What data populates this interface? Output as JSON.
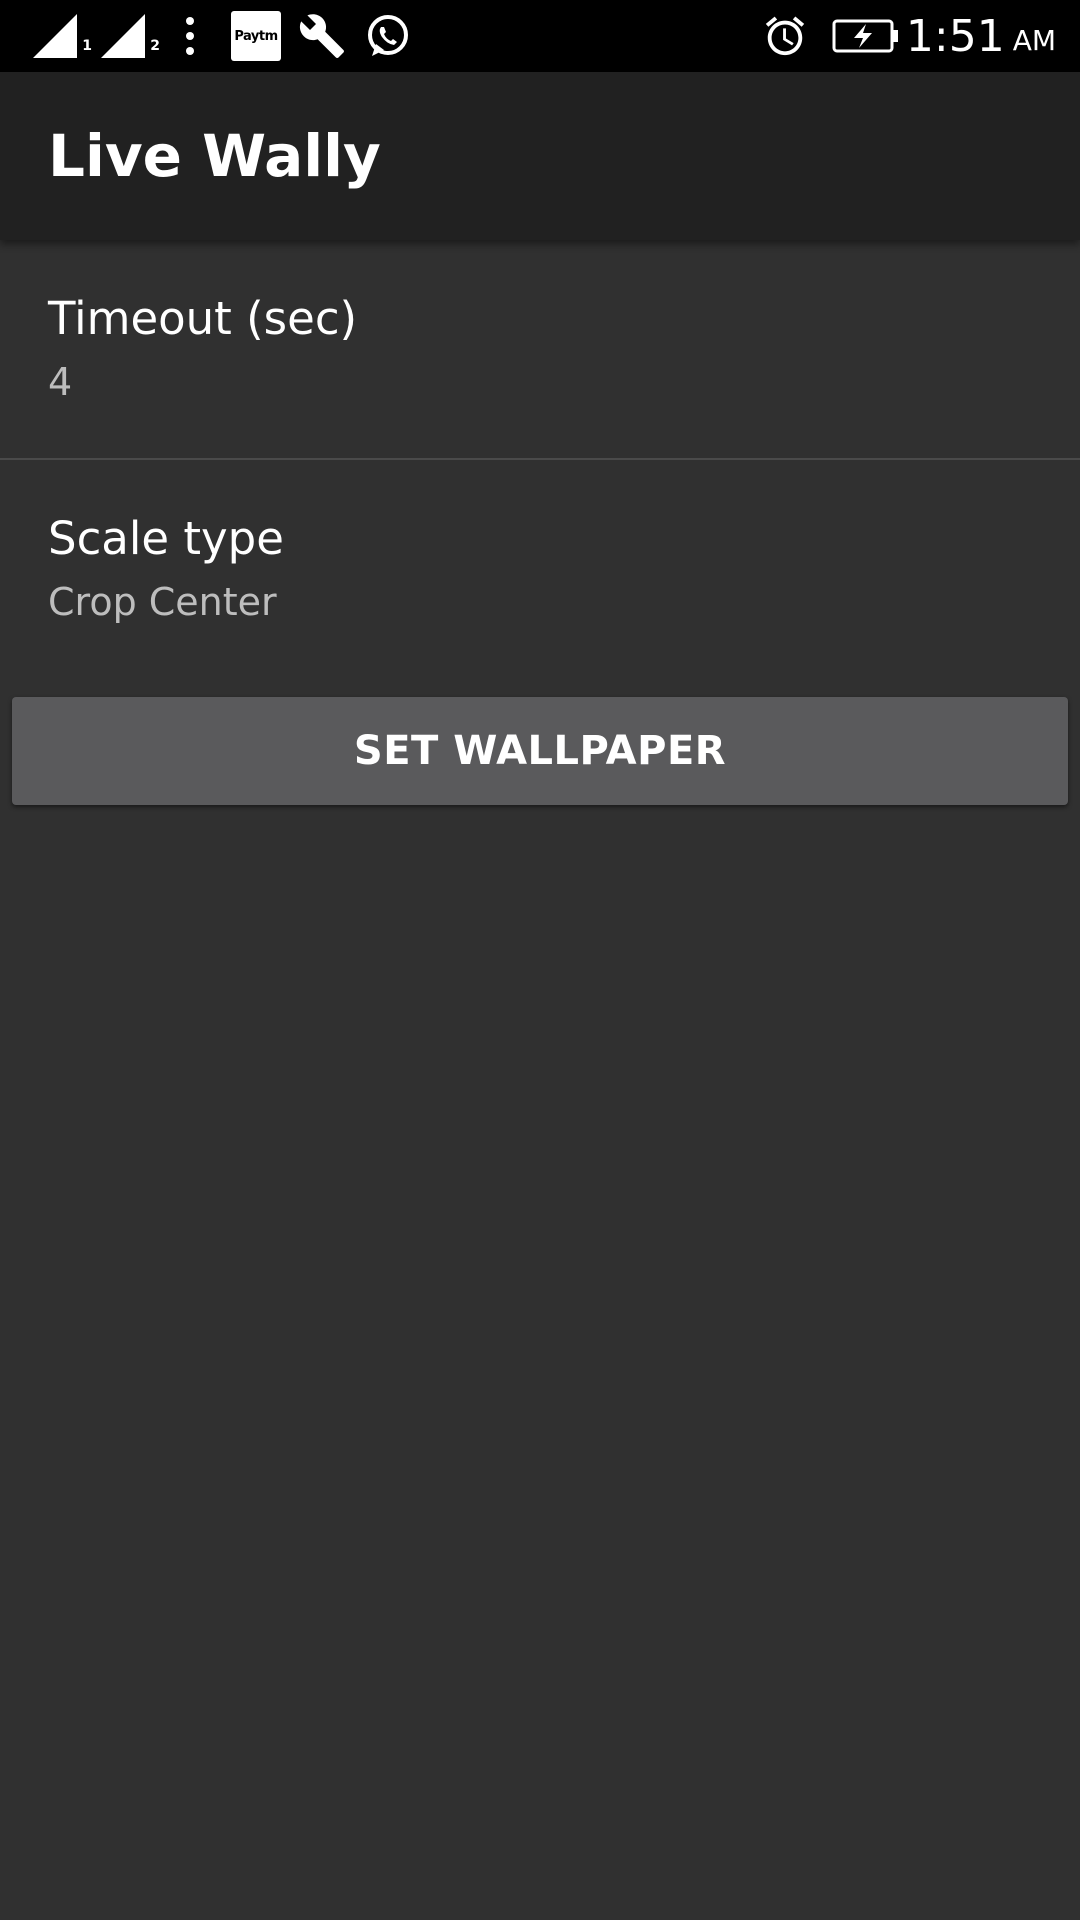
{
  "status_bar": {
    "sim1_label": "1",
    "sim2_label": "2",
    "paytm_label": "Paytm",
    "time": "1:51",
    "ampm": "AM",
    "icons": [
      "signal-sim1-icon",
      "signal-sim2-icon",
      "more-vert-icon",
      "paytm-icon",
      "wrench-icon",
      "whatsapp-icon",
      "alarm-icon",
      "battery-charging-icon"
    ]
  },
  "app_bar": {
    "title": "Live Wally"
  },
  "preferences": {
    "timeout": {
      "title": "Timeout (sec)",
      "value": "4"
    },
    "scale_type": {
      "title": "Scale type",
      "value": "Crop Center"
    }
  },
  "actions": {
    "set_wallpaper_label": "SET WALLPAPER"
  },
  "colors": {
    "background": "#303030",
    "app_bar": "#212121",
    "status_bar": "#000000",
    "button": "#5a5a5c",
    "summary_text": "#bdbdbd"
  }
}
